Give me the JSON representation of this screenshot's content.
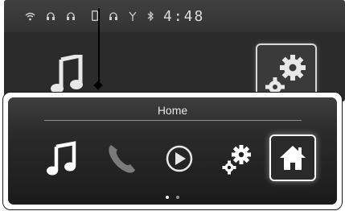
{
  "status_bar": {
    "time": "4:48",
    "icons": [
      "wifi-icon",
      "headset-icon",
      "headset-icon",
      "phone-icon",
      "headset-icon",
      "signal-icon",
      "bluetooth-icon"
    ]
  },
  "background_screen": {
    "visible_icons": [
      "music-note-icon",
      "settings-icon"
    ]
  },
  "home_menu": {
    "title": "Home",
    "items": [
      {
        "name": "audio",
        "icon": "music-note-icon"
      },
      {
        "name": "phone",
        "icon": "phone-handset-icon"
      },
      {
        "name": "media",
        "icon": "play-circle-icon"
      },
      {
        "name": "settings",
        "icon": "settings-icon"
      },
      {
        "name": "home",
        "icon": "home-icon",
        "selected": true
      }
    ],
    "page_indicator": {
      "pages": 2,
      "current": 1
    }
  },
  "colors": {
    "panel_background": "#1b1b1b",
    "icon": "#ffffff",
    "phone_icon_dim": "#7a7a7a",
    "selection_border": "#ffffff"
  }
}
